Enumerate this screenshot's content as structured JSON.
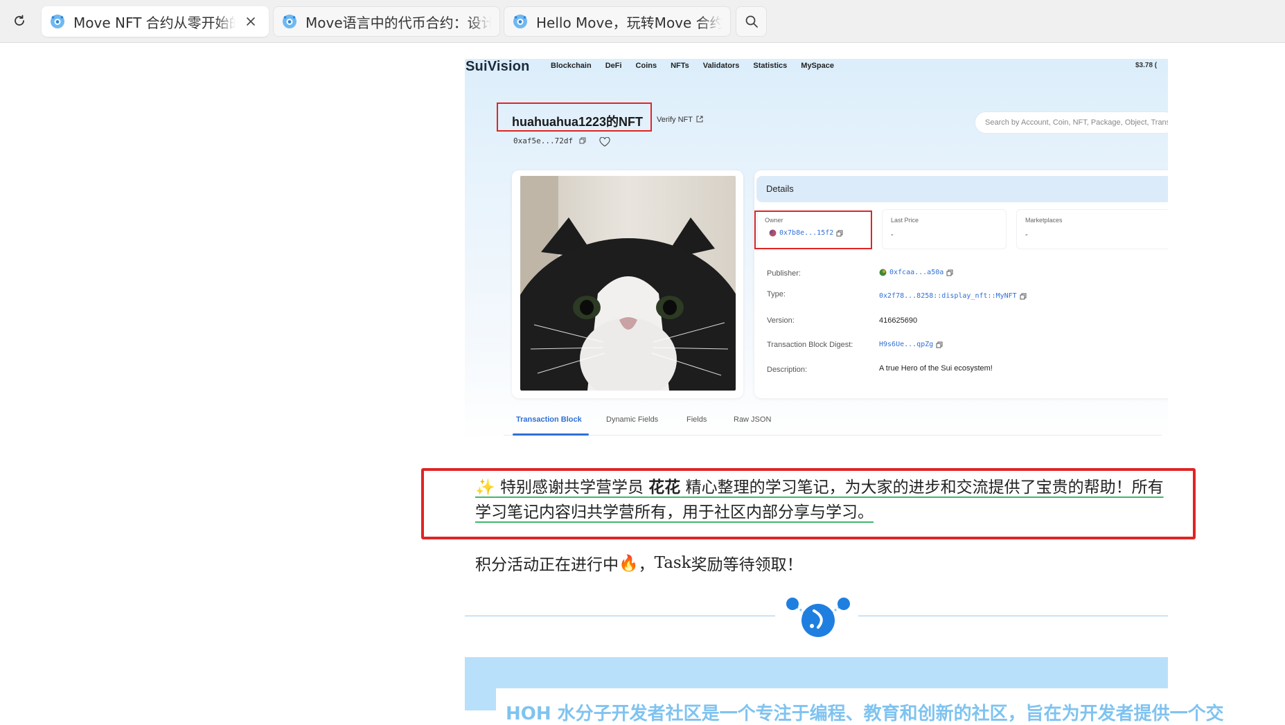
{
  "browser": {
    "reload_icon": "reload-icon",
    "search_icon": "search-icon",
    "tabs": [
      {
        "title": "Move NFT 合约从零开始的实",
        "active": true
      },
      {
        "title": "Move语言中的代币合约：设计和实",
        "active": false
      },
      {
        "title": "Hello Move，玩转Move 合约开发",
        "active": false
      }
    ]
  },
  "suivision": {
    "logo": "SuiVision",
    "nav": [
      "Blockchain",
      "DeFi",
      "Coins",
      "NFTs",
      "Validators",
      "Statistics",
      "MySpace"
    ],
    "price": "$3.78 (",
    "nft_title": "huahuahua1223的NFT",
    "verify": "Verify NFT",
    "object_id": "0xaf5e...72df",
    "search_placeholder": "Search by Account, Coin, NFT, Package, Object, Transaction",
    "details_header": "Details",
    "owner_label": "Owner",
    "owner_value": "0x7b8e...15f2",
    "last_price_label": "Last Price",
    "last_price_value": "-",
    "marketplaces_label": "Marketplaces",
    "marketplaces_value": "-",
    "rows": [
      {
        "label": "Publisher:",
        "value": "0xfcaa...a50a"
      },
      {
        "label": "Type:",
        "value": "0x2f78...8258::display_nft::MyNFT"
      },
      {
        "label": "Version:",
        "value": "416625690"
      },
      {
        "label": "Transaction Block Digest:",
        "value": "H9s6Ue...qpZg"
      },
      {
        "label": "Description:",
        "value": "A true Hero of the Sui ecosystem!"
      }
    ],
    "bottom_tabs": [
      "Transaction Block",
      "Dynamic Fields",
      "Fields",
      "Raw JSON"
    ]
  },
  "article": {
    "thanks_emoji": "✨",
    "thanks_before": " 特别感谢共学营学员 ",
    "thanks_name": "花花",
    "thanks_after": " 精心整理的学习笔记，为大家的进步和交流提供了宝贵的帮助！所有学习笔记内容归共学营所有，用于社区内部分享与学习。",
    "points_before": "积分活动正在进行中",
    "points_emoji": "🔥",
    "points_sep": "，",
    "points_task": "Task",
    "points_after": "奖励等待领取！",
    "banner_text": "HOH 水分子开发者社区是一个专注于编程、教育和创新的社区，旨在为开发者提供一个交"
  },
  "colors": {
    "highlight_red": "#e02424",
    "link_blue": "#2f6fd6",
    "underline_green": "#3db86a",
    "banner_blue": "#b9e0fb"
  }
}
